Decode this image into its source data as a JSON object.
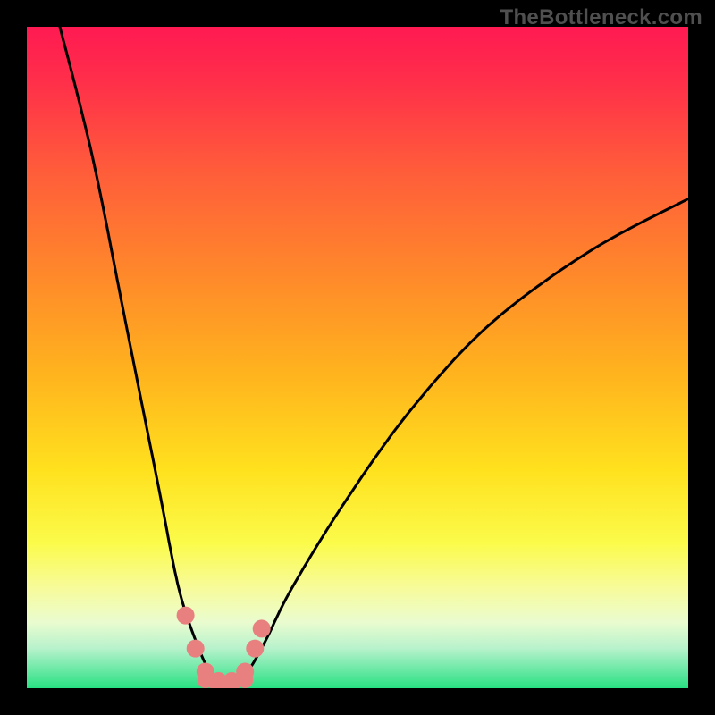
{
  "watermark": "TheBottleneck.com",
  "chart_data": {
    "type": "line",
    "title": "",
    "xlabel": "",
    "ylabel": "",
    "xlim": [
      0,
      100
    ],
    "ylim": [
      0,
      100
    ],
    "background_gradient": {
      "top_color": "#ff1a52",
      "bottom_color": "#28e083",
      "description": "vertical rainbow gradient red→orange→yellow→green representing bottleneck severity high→low"
    },
    "series": [
      {
        "name": "bottleneck-curve",
        "description": "V-shaped curve; minimum near x≈30 where bottleneck is lowest (green zone); rises steeply toward red on both sides",
        "x": [
          5,
          10,
          15,
          20,
          23,
          26,
          28,
          30,
          33,
          36,
          40,
          48,
          58,
          70,
          85,
          100
        ],
        "values": [
          100,
          80,
          55,
          30,
          15,
          6,
          2,
          0,
          2,
          7,
          15,
          28,
          42,
          55,
          66,
          74
        ]
      }
    ],
    "markers": {
      "description": "salmon-colored data points clustered near the valley bottom",
      "x": [
        24,
        25.5,
        27,
        29,
        31,
        33,
        34.5,
        35.5
      ],
      "values": [
        11,
        6,
        2.5,
        0.5,
        0.5,
        2.5,
        6,
        9
      ]
    }
  }
}
